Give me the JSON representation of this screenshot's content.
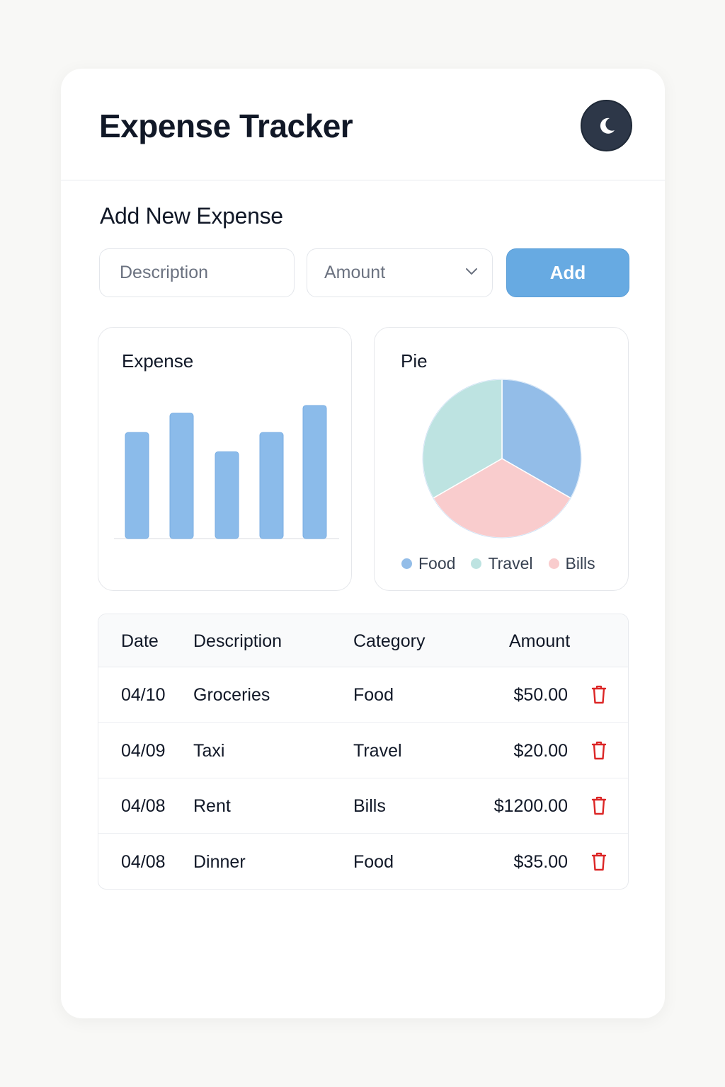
{
  "app": {
    "title": "Expense Tracker",
    "theme_toggle_icon": "moon-icon"
  },
  "form": {
    "section_title": "Add New Expense",
    "description_placeholder": "Description",
    "amount_placeholder": "Amount",
    "add_label": "Add"
  },
  "colors": {
    "accent": "#67aae2",
    "bar": "#8bbbea",
    "food": "#93bde8",
    "travel": "#bde3e1",
    "bills": "#f9cccd",
    "delete": "#dc2626"
  },
  "bar_panel": {
    "title": "Expense"
  },
  "pie_panel": {
    "title": "Pie"
  },
  "chart_data": [
    {
      "type": "bar",
      "title": "Expense",
      "categories": [
        "",
        "",
        "",
        "",
        ""
      ],
      "values": [
        55,
        65,
        45,
        55,
        69
      ],
      "ylim": [
        0,
        80
      ],
      "grid": false
    },
    {
      "type": "pie",
      "title": "Pie",
      "labels": [
        "Food",
        "Travel",
        "Bills"
      ],
      "values": [
        33.3,
        33.3,
        33.4
      ],
      "colors": [
        "#93bde8",
        "#bde3e1",
        "#f9cccd"
      ],
      "legend": "bottom"
    }
  ],
  "table": {
    "headers": {
      "date": "Date",
      "description": "Description",
      "category": "Category",
      "amount": "Amount"
    },
    "rows": [
      {
        "date": "04/10",
        "description": "Groceries",
        "category": "Food",
        "amount": "$50.00"
      },
      {
        "date": "04/09",
        "description": "Taxi",
        "category": "Travel",
        "amount": "$20.00"
      },
      {
        "date": "04/08",
        "description": "Rent",
        "category": "Bills",
        "amount": "$1200.00"
      },
      {
        "date": "04/08",
        "description": "Dinner",
        "category": "Food",
        "amount": "$35.00"
      }
    ],
    "delete_icon": "trash-icon"
  }
}
